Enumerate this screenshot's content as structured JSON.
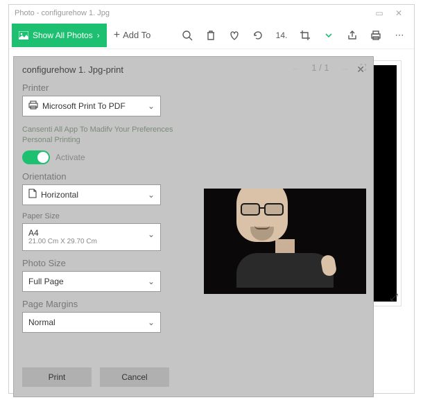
{
  "window": {
    "title": "Photo - configurehow 1. Jpg"
  },
  "toolbar": {
    "show_all": "Show All Photos",
    "add_to": "Add To",
    "zoom_label": "14."
  },
  "panel": {
    "title": "configurehow 1. Jpg-print",
    "printer_label": "Printer",
    "printer_value": "Microsoft Print To PDF",
    "consent_line1": "Cansenti All App To Madifv Your Preferences",
    "consent_line2": "Personal Printing",
    "activate": "Activate",
    "orientation_label": "Orientation",
    "orientation_value": "Horizontal",
    "paper_label": "Paper Size",
    "paper_value": "A4",
    "paper_sub": "21.00 Cm X 29.70 Cm",
    "photo_size_label": "Photo Size",
    "photo_size_value": "Full Page",
    "margins_label": "Page Margins",
    "margins_value": "Normal",
    "print_btn": "Print",
    "cancel_btn": "Cancel"
  },
  "preview": {
    "page": "1 / 1"
  }
}
